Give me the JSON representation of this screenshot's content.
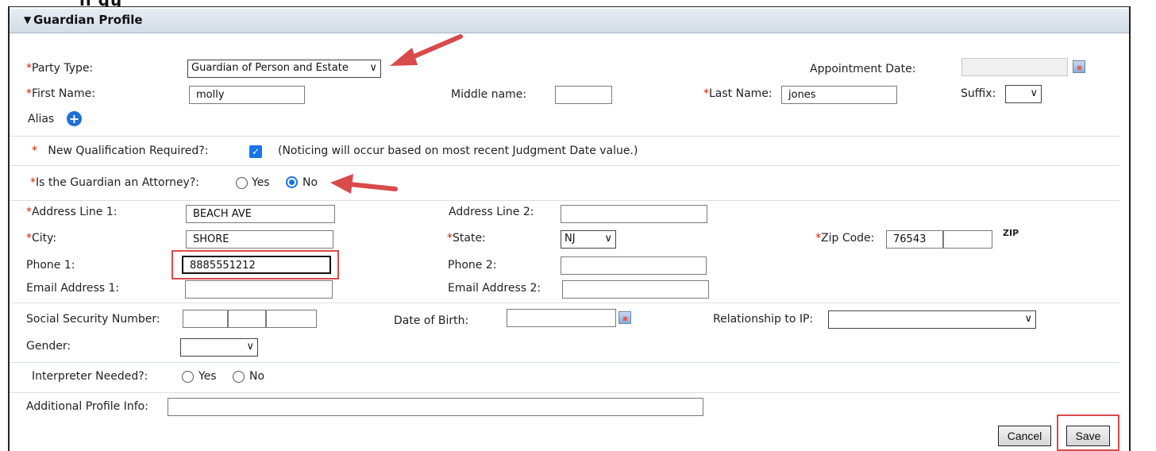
{
  "panel": {
    "title": "Guardian Profile"
  },
  "top_glyphs": "ıı ǥɥ",
  "form": {
    "party_type": {
      "label": "Party Type:",
      "value": "Guardian of Person and Estate"
    },
    "appointment_date": {
      "label": "Appointment Date:",
      "value": ""
    },
    "first_name": {
      "label": "First Name:",
      "value": "molly"
    },
    "middle_name": {
      "label": "Middle name:",
      "value": ""
    },
    "last_name": {
      "label": "Last Name:",
      "value": "jones"
    },
    "suffix": {
      "label": "Suffix:",
      "value": ""
    },
    "alias": {
      "label": "Alias"
    },
    "new_qualification": {
      "label": "New Qualification Required?:",
      "note": "(Noticing will occur based on most recent Judgment Date value.)",
      "checked": true
    },
    "is_attorney": {
      "label": "Is the Guardian an Attorney?:",
      "yes": "Yes",
      "no": "No",
      "selected": "No"
    },
    "address1": {
      "label": "Address Line 1:",
      "value": "BEACH AVE"
    },
    "address2": {
      "label": "Address Line 2:",
      "value": ""
    },
    "city": {
      "label": "City:",
      "value": "SHORE"
    },
    "state": {
      "label": "State:",
      "value": "NJ"
    },
    "zip": {
      "label": "Zip Code:",
      "value": "76543",
      "ext": "",
      "icon_text": "ZIP"
    },
    "phone1": {
      "label": "Phone 1:",
      "value": "8885551212"
    },
    "phone2": {
      "label": "Phone 2:",
      "value": ""
    },
    "email1": {
      "label": "Email Address 1:",
      "value": ""
    },
    "email2": {
      "label": "Email Address 2:",
      "value": ""
    },
    "ssn": {
      "label": "Social Security Number:"
    },
    "dob": {
      "label": "Date of Birth:",
      "value": ""
    },
    "relationship": {
      "label": "Relationship to IP:",
      "value": ""
    },
    "gender": {
      "label": "Gender:",
      "value": ""
    },
    "interpreter": {
      "label": "Interpreter Needed?:",
      "yes": "Yes",
      "no": "No"
    },
    "additional": {
      "label": "Additional Profile Info:",
      "value": ""
    }
  },
  "buttons": {
    "cancel": "Cancel",
    "save": "Save"
  },
  "required_mark": "*",
  "colors": {
    "annotation_red": "#d94a4a",
    "accent_blue": "#1a73e8"
  }
}
